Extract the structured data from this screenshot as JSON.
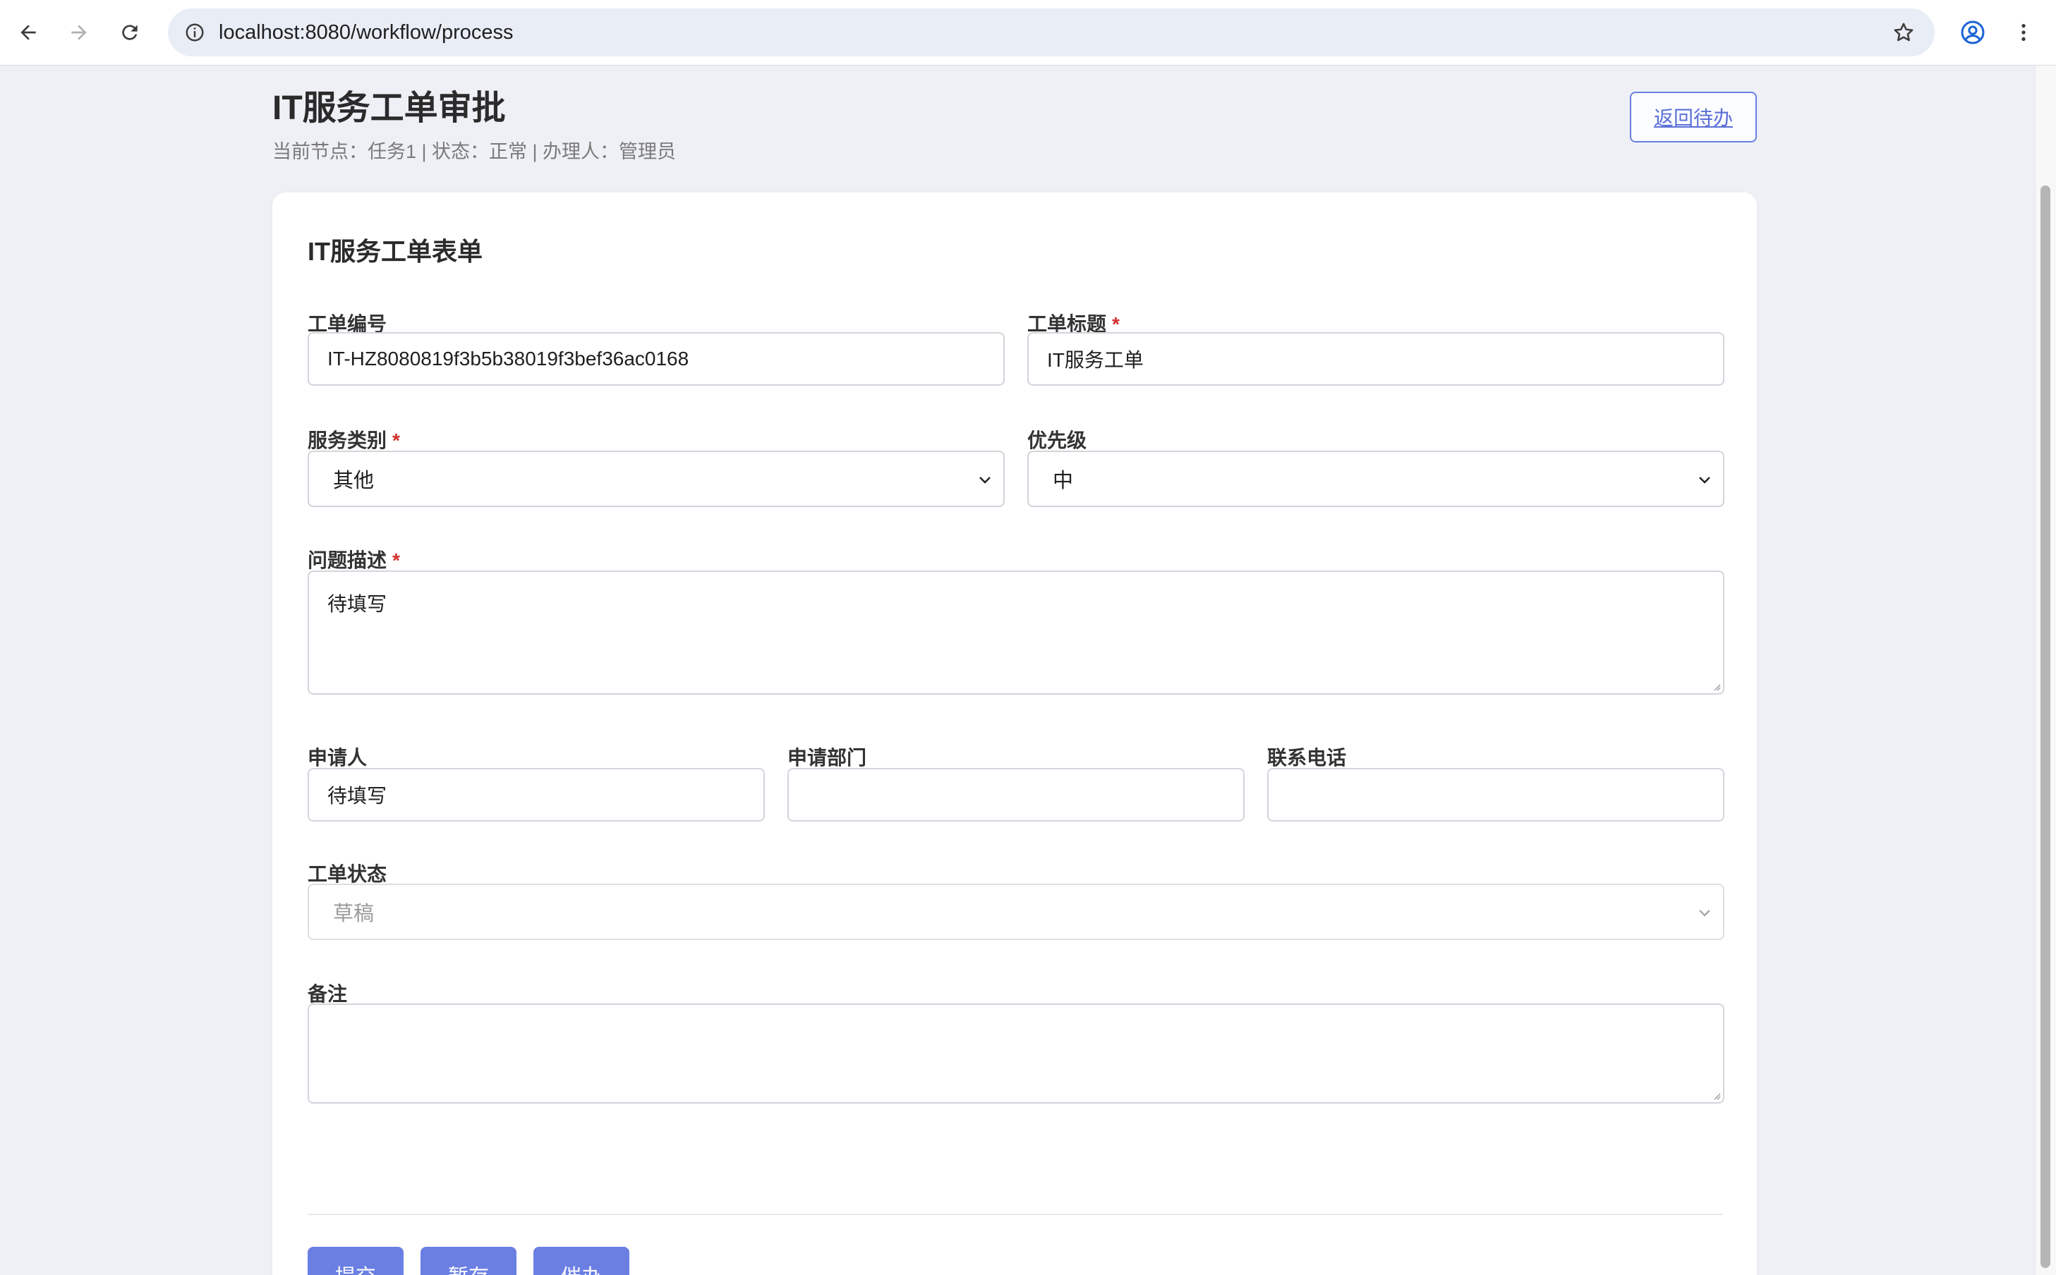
{
  "browser": {
    "url": "localhost:8080/workflow/process",
    "icons": [
      "back-arrow-icon",
      "forward-arrow-icon",
      "reload-icon",
      "site-info-icon",
      "bookmark-star-icon",
      "profile-icon",
      "kebab-menu-icon"
    ]
  },
  "header": {
    "title": "IT服务工单审批",
    "subtitle": "当前节点：任务1 | 状态：正常 | 办理人：管理员",
    "back_label": "返回待办"
  },
  "form": {
    "title": "IT服务工单表单",
    "required_mark": "*",
    "ticket_no": {
      "label": "工单编号",
      "value": "IT-HZ8080819f3b5b38019f3bef36ac0168"
    },
    "ticket_title": {
      "label": "工单标题",
      "value": "IT服务工单"
    },
    "category": {
      "label": "服务类别",
      "value": "其他"
    },
    "priority": {
      "label": "优先级",
      "value": "中"
    },
    "description": {
      "label": "问题描述",
      "value": "待填写"
    },
    "applicant": {
      "label": "申请人",
      "value": "待填写"
    },
    "department": {
      "label": "申请部门",
      "value": ""
    },
    "phone": {
      "label": "联系电话",
      "value": ""
    },
    "status": {
      "label": "工单状态",
      "value": "草稿"
    },
    "remark": {
      "label": "备注",
      "value": ""
    }
  },
  "actions": {
    "submit": "提交",
    "save_draft": "暂存",
    "urge": "催办"
  },
  "colors": {
    "accent": "#6b7fe3",
    "required": "#d23030",
    "link": "#5a6fd8"
  }
}
